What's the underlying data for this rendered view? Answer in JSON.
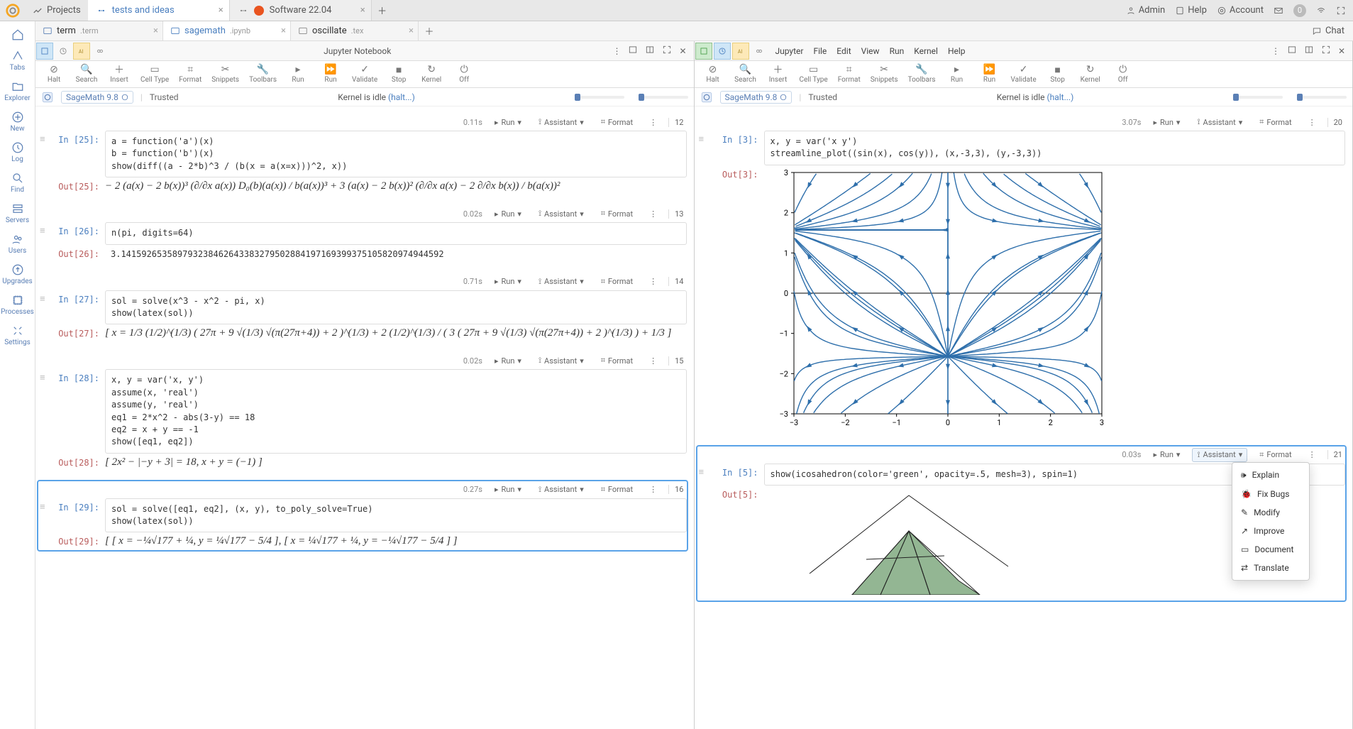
{
  "projectbar": {
    "projects_label": "Projects",
    "tab1": "tests and ideas",
    "tab2": "Software 22.04",
    "admin": "Admin",
    "help": "Help",
    "account": "Account",
    "notif_count": "0"
  },
  "rail": {
    "tabs": "Tabs",
    "explorer": "Explorer",
    "new": "New",
    "log": "Log",
    "find": "Find",
    "servers": "Servers",
    "users": "Users",
    "upgrades": "Upgrades",
    "processes": "Processes",
    "settings": "Settings"
  },
  "filetabs": {
    "tab1_name": "term",
    "tab1_ext": ".term",
    "tab2_name": "sagemath",
    "tab2_ext": ".ipynb",
    "tab3_name": "oscillate",
    "tab3_ext": ".tex",
    "chat": "Chat"
  },
  "left_head": {
    "title": "Jupyter Notebook"
  },
  "right_head": {
    "menu_jupyter": "Jupyter",
    "menu_file": "File",
    "menu_edit": "Edit",
    "menu_view": "View",
    "menu_run": "Run",
    "menu_kernel": "Kernel",
    "menu_help": "Help"
  },
  "toolbar": {
    "halt": "Halt",
    "search": "Search",
    "insert": "Insert",
    "celltype": "Cell Type",
    "format": "Format",
    "snippets": "Snippets",
    "toolbars": "Toolbars",
    "run": "Run",
    "run_all": "Run",
    "validate": "Validate",
    "stop": "Stop",
    "kernel": "Kernel",
    "off": "Off"
  },
  "kstatus": {
    "kernel": "SageMath 9.8",
    "trusted": "Trusted",
    "idle_prefix": "Kernel is idle ",
    "halt_link": "(halt...)"
  },
  "celltop": {
    "run": "Run",
    "assistant": "Assistant",
    "format": "Format"
  },
  "left_cells": {
    "c25": {
      "time": "0.11s",
      "num": "12",
      "in_label": "In [25]:",
      "out_label": "Out[25]:",
      "code": "a = function('a')(x)\nb = function('b')(x)\nshow(diff((a - 2*b)^3 / (b(x = a(x=x)))^2, x))",
      "math": "− 2 (a(x) − 2 b(x))³ (∂/∂x a(x)) D₀(b)(a(x)) / b(a(x))³  +  3 (a(x) − 2 b(x))² (∂/∂x a(x) − 2 ∂/∂x b(x)) / b(a(x))²"
    },
    "c26": {
      "time": "0.02s",
      "num": "13",
      "in_label": "In [26]:",
      "out_label": "Out[26]:",
      "code": "n(pi, digits=64)",
      "out": "3.141592653589793238462643383279502884197169399375105820974944592"
    },
    "c27": {
      "time": "0.71s",
      "num": "14",
      "in_label": "In [27]:",
      "out_label": "Out[27]:",
      "code": "sol = solve(x^3 - x^2 - pi, x)\nshow(latex(sol))",
      "math": "[ x = 1/3 (1/2)^(1/3) ( 27π + 9 √(1/3) √(π(27π+4)) + 2 )^(1/3)  +  2 (1/2)^(1/3) / ( 3 ( 27π + 9 √(1/3) √(π(27π+4)) + 2 )^(1/3) )  +  1/3 ]"
    },
    "c28": {
      "time": "0.02s",
      "num": "15",
      "in_label": "In [28]:",
      "out_label": "Out[28]:",
      "code": "x, y = var('x, y')\nassume(x, 'real')\nassume(y, 'real')\neq1 = 2*x^2 - abs(3-y) == 18\neq2 = x + y == -1\nshow([eq1, eq2])",
      "math": "[ 2x² − |−y + 3| = 18,  x + y = (−1) ]"
    },
    "c29": {
      "time": "0.27s",
      "num": "16",
      "in_label": "In [29]:",
      "out_label": "Out[29]:",
      "code": "sol = solve([eq1, eq2], (x, y), to_poly_solve=True)\nshow(latex(sol))",
      "math": "[ [ x = −¼√177 + ¼,  y = ¼√177 − 5/4 ],  [ x = ¼√177 + ¼,  y = −¼√177 − 5/4 ] ]"
    }
  },
  "right_cells": {
    "c3": {
      "time": "3.07s",
      "num": "20",
      "in_label": "In [3]:",
      "out_label": "Out[3]:",
      "code": "x, y = var('x y')\nstreamline_plot((sin(x), cos(y)), (x,-3,3), (y,-3,3))"
    },
    "c5": {
      "time": "0.03s",
      "num": "21",
      "in_label": "In [5]:",
      "out_label": "Out[5]:",
      "code": "show(icosahedron(color='green', opacity=.5, mesh=3), spin=1)"
    }
  },
  "assist_menu": {
    "explain": "Explain",
    "fixbugs": "Fix Bugs",
    "modify": "Modify",
    "improve": "Improve",
    "document": "Document",
    "translate": "Translate"
  },
  "chart_data": {
    "type": "streamline",
    "title": "",
    "xlabel": "",
    "ylabel": "",
    "xlim": [
      -3,
      3
    ],
    "ylim": [
      -3,
      3
    ],
    "xticks": [
      -3,
      -2,
      -1,
      0,
      1,
      2,
      3
    ],
    "yticks": [
      -3,
      -2,
      -1,
      0,
      1,
      2,
      3
    ],
    "vector_field": {
      "u": "sin(x)",
      "v": "cos(y)"
    },
    "note": "streamline plot of (sin(x), cos(y)) over [-3,3]×[-3,3]; saddle-like flow structure with separatrices near x=0 and y≈±π/2"
  }
}
